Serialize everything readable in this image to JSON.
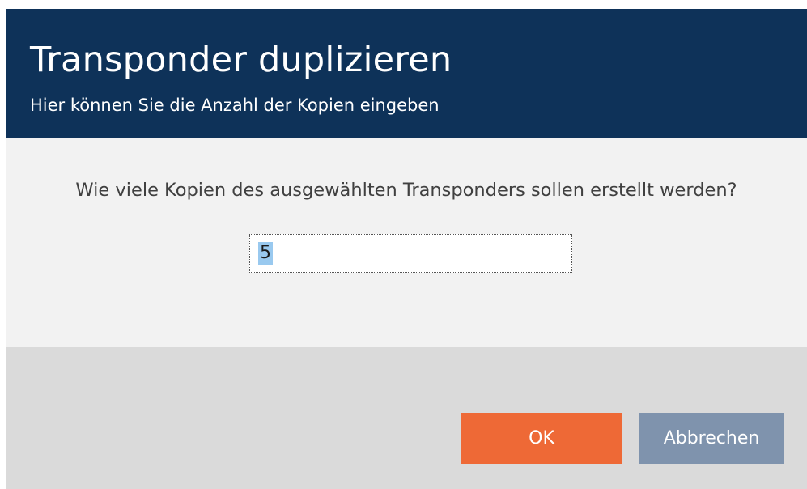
{
  "dialog": {
    "title": "Transponder duplizieren",
    "subtitle": "Hier können Sie die Anzahl der Kopien eingeben"
  },
  "body": {
    "question": "Wie viele Kopien des ausgewählten Transponders sollen erstellt werden?",
    "copies_input": {
      "value": "5",
      "selected": true
    }
  },
  "footer": {
    "ok_label": "OK",
    "cancel_label": "Abbrechen"
  },
  "colors": {
    "header_bg": "#0e3259",
    "body_bg": "#f2f2f2",
    "footer_bg": "#dadada",
    "ok_button": "#ee6936",
    "cancel_button": "#7f93ad",
    "selection_highlight": "#99c9ef"
  }
}
